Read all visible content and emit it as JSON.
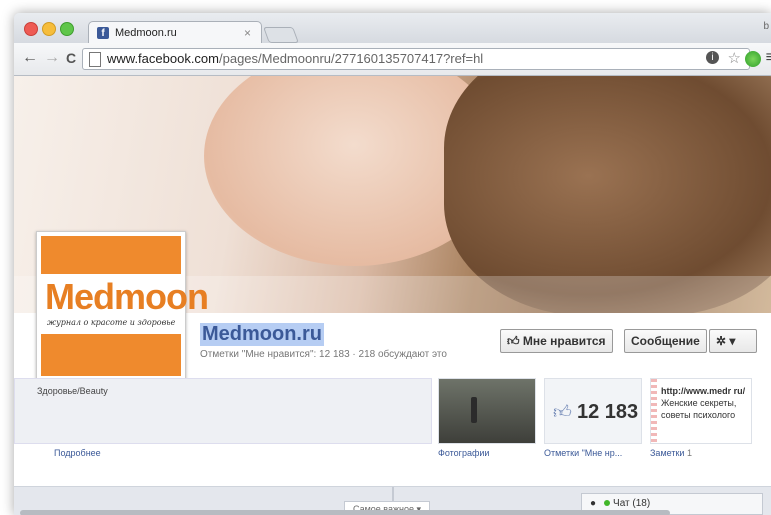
{
  "browser": {
    "tab_title": "Medmoon.ru",
    "tab_close": "×",
    "corner_text": "b",
    "url_host": "www.facebook.com",
    "url_path": "/pages/Medmoonru/277160135707417?ref=hl",
    "back": "←",
    "forward": "→",
    "reload": "C",
    "star": "☆",
    "info": "i",
    "menu": "≡"
  },
  "page": {
    "name": "Medmoon.ru",
    "stats": "Отметки \"Мне нравится\": 12 183 · 218 обсуждают это",
    "logo_text": "Medmoon",
    "logo_slogan": "журнал о красоте и здоровье",
    "like_button": "Мне нравится",
    "message_button": "Сообщение",
    "gear_button": "✲ ▾"
  },
  "about": {
    "category": "Здоровье/Beauty",
    "more_link": "Подробнее"
  },
  "tiles": {
    "photos_label": "Фотографии",
    "likes_count": "12 183",
    "likes_label": "Отметки \"Мне нр...",
    "notes_url": "http://www.medr ru/",
    "notes_line1": "Женские секреты,",
    "notes_line2": "советы психолого",
    "notes_label": "Заметки",
    "notes_count": "1"
  },
  "timeline": {
    "selector": "Самое важное ▾",
    "chat": "Чат (18)"
  },
  "colors": {
    "fb_blue": "#3b5998",
    "logo_orange": "#ef8a2d"
  }
}
